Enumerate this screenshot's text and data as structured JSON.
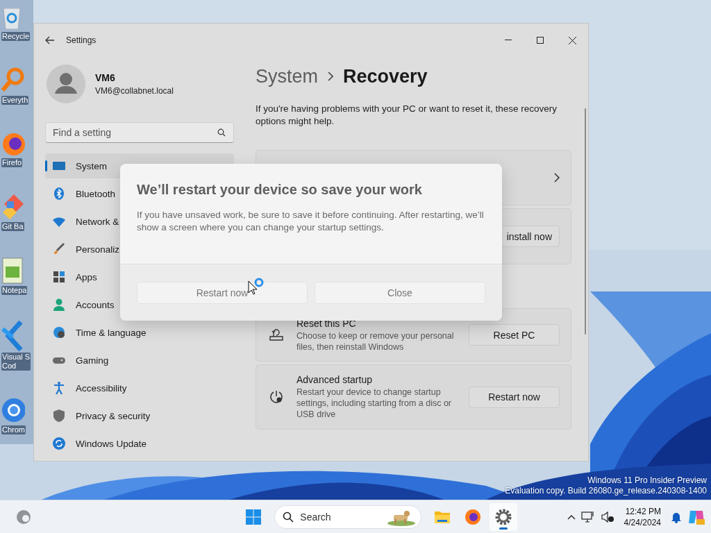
{
  "desktop_icons": [
    {
      "kind": "bin",
      "label": "Recycle"
    },
    {
      "kind": "magnifier",
      "label": "Everyth"
    },
    {
      "kind": "fox",
      "label": "Firefo"
    },
    {
      "kind": "diamond",
      "label": "Git Ba"
    },
    {
      "kind": "notepad",
      "label": "Notepa"
    },
    {
      "kind": "code",
      "label": "Visual S\nCod"
    },
    {
      "kind": "ring",
      "label": "Chrom"
    }
  ],
  "window": {
    "title": "Settings",
    "account": {
      "name": "VM6",
      "email": "VM6@collabnet.local"
    },
    "search": {
      "placeholder": "Find a setting"
    },
    "nav": [
      {
        "kind": "system",
        "label": "System",
        "selected": true
      },
      {
        "kind": "bluetooth",
        "label": "Bluetooth",
        "selected": false
      },
      {
        "kind": "network",
        "label": "Network &",
        "selected": false
      },
      {
        "kind": "brush",
        "label": "Personaliz",
        "selected": false
      },
      {
        "kind": "apps",
        "label": "Apps",
        "selected": false
      },
      {
        "kind": "accounts",
        "label": "Accounts",
        "selected": false
      },
      {
        "kind": "time",
        "label": "Time & language",
        "selected": false
      },
      {
        "kind": "gaming",
        "label": "Gaming",
        "selected": false
      },
      {
        "kind": "accessibility",
        "label": "Accessibility",
        "selected": false
      },
      {
        "kind": "privacy",
        "label": "Privacy & security",
        "selected": false
      },
      {
        "kind": "update",
        "label": "Windows Update",
        "selected": false
      }
    ],
    "breadcrumb": [
      "System",
      "Recovery"
    ],
    "intro": "If you're having problems with your PC or want to reset it, these recovery options might help.",
    "cards": [
      {
        "kind": "link"
      },
      {
        "kind": "partial",
        "button": "install now"
      },
      {
        "kind": "reset",
        "title": "Reset this PC",
        "description": "Choose to keep or remove your personal files, then reinstall Windows",
        "button": "Reset PC"
      },
      {
        "kind": "startup",
        "title": "Advanced startup",
        "description": "Restart your device to change startup settings, including starting from a disc or USB drive",
        "button": "Restart now"
      }
    ]
  },
  "dialog": {
    "title": "We’ll restart your device so save your work",
    "message": "If you have unsaved work, be sure to save it before continuing. After restarting, we’ll show a screen where you can change your startup settings.",
    "buttons": [
      "Restart now",
      "Close"
    ]
  },
  "notice": [
    "Windows 11 Pro Insider Preview",
    "Evaluation copy. Build 26080.ge_release.240308-1400"
  ],
  "taskbar": {
    "search": {
      "placeholder": "Search"
    },
    "apps": [
      {
        "kind": "folder",
        "selected": false
      },
      {
        "kind": "fox",
        "selected": false
      },
      {
        "kind": "gear",
        "selected": true
      }
    ],
    "time": "12:42 PM",
    "date": "4/24/2024"
  }
}
